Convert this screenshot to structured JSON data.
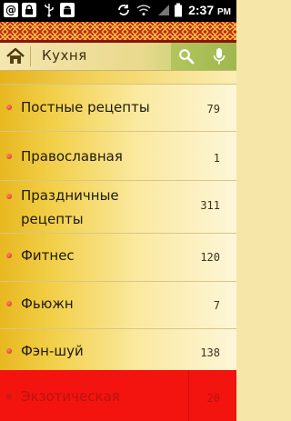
{
  "status_bar": {
    "time": "2:37",
    "time_suffix": "PM",
    "icons": [
      "at-sign-icon",
      "lock-icon",
      "usb-icon",
      "android-icon",
      "sync-icon",
      "wifi-icon",
      "signal-icon",
      "battery-icon"
    ]
  },
  "action_bar": {
    "title": "Кухня",
    "icons": [
      "home-icon",
      "search-icon",
      "microphone-icon"
    ]
  },
  "list": {
    "items": [
      {
        "label": "Постные рецепты",
        "count": "79"
      },
      {
        "label": "Православная",
        "count": "1"
      },
      {
        "label": "Праздничные рецепты",
        "count": "311"
      },
      {
        "label": "Фитнес",
        "count": "120"
      },
      {
        "label": "Фьюжн",
        "count": "7"
      },
      {
        "label": "Фэн-шуй",
        "count": "138"
      },
      {
        "label": "Экзотическая",
        "count": "20"
      }
    ]
  },
  "colors": {
    "selected_row": "#f3130f",
    "bullet": "#d02a12",
    "ornament_red": "#c3211c",
    "ornament_gold": "#f2c13a"
  }
}
